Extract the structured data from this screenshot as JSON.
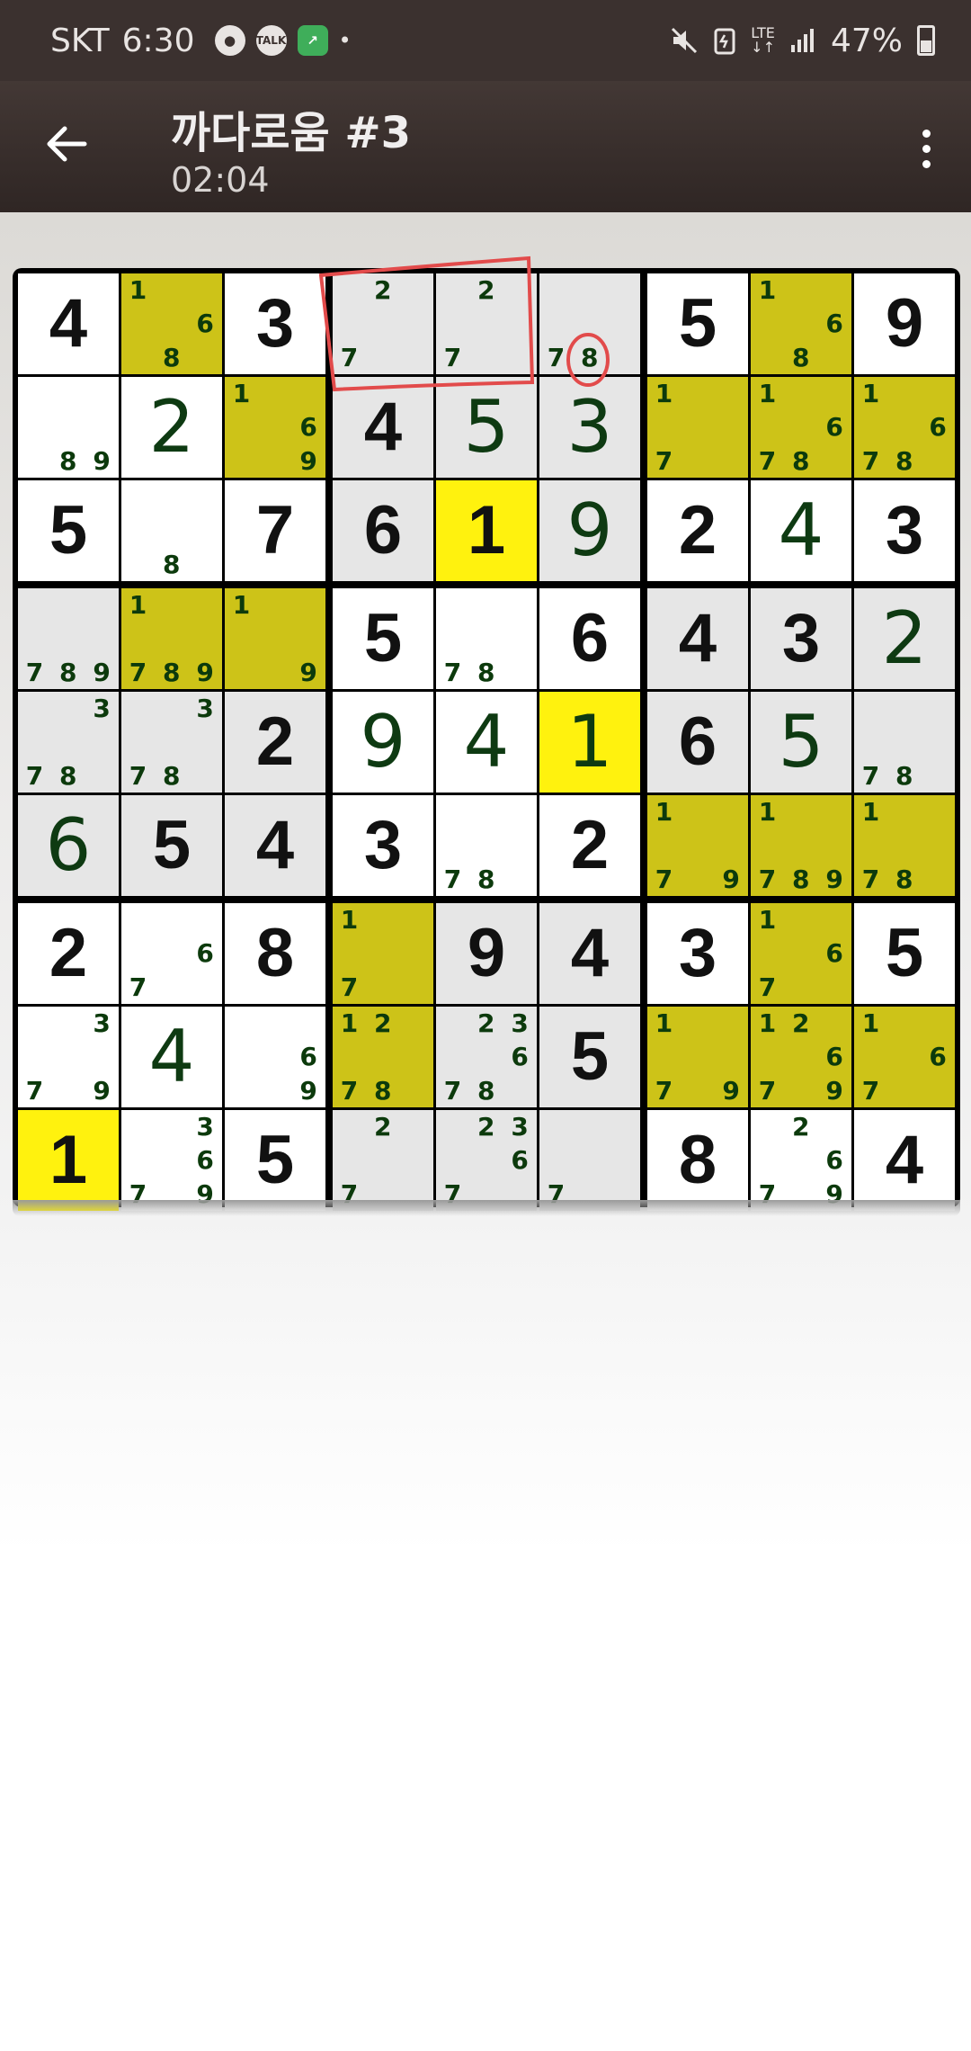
{
  "status_bar": {
    "carrier": "SKT",
    "time": "6:30",
    "apps": [
      "game-icon",
      "talk-icon",
      "app-icon"
    ],
    "talk_label": "TALK",
    "battery": "47%",
    "network": "LTE"
  },
  "header": {
    "title": "까다로움 #3",
    "timer": "02:04"
  },
  "colors": {
    "selected": "#fff20e",
    "highlight": "#cdc318",
    "related": "#e6e6e6",
    "annotation": "#e24b4b"
  },
  "board": {
    "rows": [
      [
        {
          "v": "4",
          "t": "g"
        },
        {
          "pm": [
            "1",
            "6",
            "8"
          ],
          "b": "olive"
        },
        {
          "v": "3",
          "t": "g"
        },
        {
          "pm": [
            "2",
            "7"
          ],
          "b": "gray"
        },
        {
          "pm": [
            "2",
            "7"
          ],
          "b": "gray"
        },
        {
          "pm": [
            "7",
            "8"
          ],
          "b": "gray"
        },
        {
          "v": "5",
          "t": "g"
        },
        {
          "pm": [
            "1",
            "6",
            "8"
          ],
          "b": "olive"
        },
        {
          "v": "9",
          "t": "g"
        }
      ],
      [
        {
          "pm": [
            "8",
            "9"
          ]
        },
        {
          "v": "2",
          "t": "u"
        },
        {
          "pm": [
            "1",
            "6",
            "9"
          ],
          "b": "olive"
        },
        {
          "v": "4",
          "t": "g",
          "b": "gray"
        },
        {
          "v": "5",
          "t": "u",
          "b": "gray"
        },
        {
          "v": "3",
          "t": "u",
          "b": "gray"
        },
        {
          "pm": [
            "1",
            "7"
          ],
          "b": "olive"
        },
        {
          "pm": [
            "1",
            "6",
            "7",
            "8"
          ],
          "b": "olive"
        },
        {
          "pm": [
            "1",
            "6",
            "7",
            "8"
          ],
          "b": "olive"
        }
      ],
      [
        {
          "v": "5",
          "t": "g"
        },
        {
          "pm": [
            "8"
          ]
        },
        {
          "v": "7",
          "t": "g"
        },
        {
          "v": "6",
          "t": "g",
          "b": "gray"
        },
        {
          "v": "1",
          "t": "g",
          "b": "sel"
        },
        {
          "v": "9",
          "t": "u",
          "b": "gray"
        },
        {
          "v": "2",
          "t": "g"
        },
        {
          "v": "4",
          "t": "u"
        },
        {
          "v": "3",
          "t": "g"
        }
      ],
      [
        {
          "pm": [
            "7",
            "8",
            "9"
          ],
          "b": "gray"
        },
        {
          "pm": [
            "1",
            "7",
            "8",
            "9"
          ],
          "b": "olive"
        },
        {
          "pm": [
            "1",
            "9"
          ],
          "b": "olive"
        },
        {
          "v": "5",
          "t": "g"
        },
        {
          "pm": [
            "7",
            "8"
          ]
        },
        {
          "v": "6",
          "t": "g"
        },
        {
          "v": "4",
          "t": "g",
          "b": "gray"
        },
        {
          "v": "3",
          "t": "g",
          "b": "gray"
        },
        {
          "v": "2",
          "t": "u",
          "b": "gray"
        }
      ],
      [
        {
          "pm": [
            "3",
            "7",
            "8"
          ],
          "b": "gray"
        },
        {
          "pm": [
            "3",
            "7",
            "8"
          ],
          "b": "gray"
        },
        {
          "v": "2",
          "t": "g",
          "b": "gray"
        },
        {
          "v": "9",
          "t": "u"
        },
        {
          "v": "4",
          "t": "u"
        },
        {
          "v": "1",
          "t": "u",
          "b": "sel"
        },
        {
          "v": "6",
          "t": "g",
          "b": "gray"
        },
        {
          "v": "5",
          "t": "u",
          "b": "gray"
        },
        {
          "pm": [
            "7",
            "8"
          ],
          "b": "gray"
        }
      ],
      [
        {
          "v": "6",
          "t": "u",
          "b": "gray"
        },
        {
          "v": "5",
          "t": "g",
          "b": "gray"
        },
        {
          "v": "4",
          "t": "g",
          "b": "gray"
        },
        {
          "v": "3",
          "t": "g"
        },
        {
          "pm": [
            "7",
            "8"
          ]
        },
        {
          "v": "2",
          "t": "g"
        },
        {
          "pm": [
            "1",
            "7",
            "9"
          ],
          "b": "olive"
        },
        {
          "pm": [
            "1",
            "7",
            "8",
            "9"
          ],
          "b": "olive"
        },
        {
          "pm": [
            "1",
            "7",
            "8"
          ],
          "b": "olive"
        }
      ],
      [
        {
          "v": "2",
          "t": "g"
        },
        {
          "pm": [
            "6",
            "7"
          ]
        },
        {
          "v": "8",
          "t": "g"
        },
        {
          "pm": [
            "1",
            "7"
          ],
          "b": "olive"
        },
        {
          "v": "9",
          "t": "g",
          "b": "gray"
        },
        {
          "v": "4",
          "t": "g",
          "b": "gray"
        },
        {
          "v": "3",
          "t": "g"
        },
        {
          "pm": [
            "1",
            "6",
            "7"
          ],
          "b": "olive"
        },
        {
          "v": "5",
          "t": "g"
        }
      ],
      [
        {
          "pm": [
            "3",
            "7",
            "9"
          ]
        },
        {
          "v": "4",
          "t": "u"
        },
        {
          "pm": [
            "6",
            "9"
          ]
        },
        {
          "pm": [
            "1",
            "2",
            "7",
            "8"
          ],
          "b": "olive"
        },
        {
          "pm": [
            "2",
            "3",
            "6",
            "7",
            "8"
          ],
          "b": "gray"
        },
        {
          "v": "5",
          "t": "g",
          "b": "gray"
        },
        {
          "pm": [
            "1",
            "7",
            "9"
          ],
          "b": "olive"
        },
        {
          "pm": [
            "1",
            "2",
            "6",
            "7",
            "9"
          ],
          "b": "olive"
        },
        {
          "pm": [
            "1",
            "6",
            "7"
          ],
          "b": "olive"
        }
      ],
      [
        {
          "v": "1",
          "t": "g",
          "b": "sel"
        },
        {
          "pm": [
            "3",
            "6",
            "7",
            "9"
          ]
        },
        {
          "v": "5",
          "t": "g"
        },
        {
          "pm": [
            "2",
            "7"
          ],
          "b": "gray"
        },
        {
          "pm": [
            "2",
            "3",
            "6",
            "7"
          ],
          "b": "gray"
        },
        {
          "pm": [
            "7"
          ],
          "b": "gray"
        },
        {
          "v": "8",
          "t": "g"
        },
        {
          "pm": [
            "2",
            "6",
            "7",
            "9"
          ]
        },
        {
          "v": "4",
          "t": "g"
        }
      ]
    ]
  }
}
